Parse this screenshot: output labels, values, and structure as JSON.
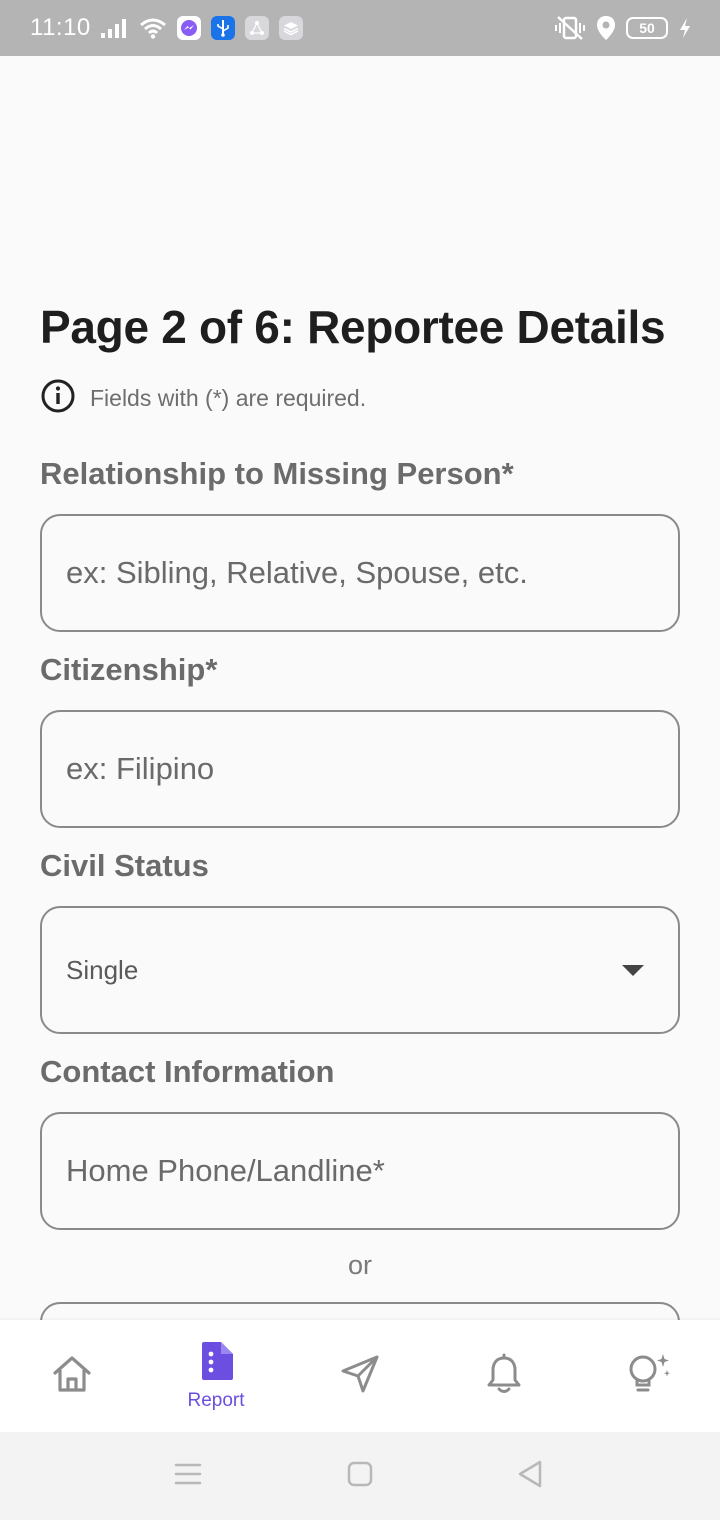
{
  "status_bar": {
    "time": "11:10",
    "battery": "50",
    "app_icons": [
      "messenger-icon",
      "usb-icon",
      "share-icon",
      "layers-icon"
    ],
    "right_icons": [
      "vibrate-off-icon",
      "location-icon",
      "battery-icon",
      "charging-icon"
    ]
  },
  "page": {
    "title": "Page 2 of 6: Reportee Details",
    "required_note": "Fields with (*) are required."
  },
  "form": {
    "relationship": {
      "label": "Relationship to Missing Person*",
      "placeholder": "ex: Sibling, Relative, Spouse, etc.",
      "value": ""
    },
    "citizenship": {
      "label": "Citizenship*",
      "placeholder": "ex: Filipino",
      "value": ""
    },
    "civil_status": {
      "label": "Civil Status",
      "selected": "Single"
    },
    "contact": {
      "label": "Contact Information",
      "home_phone_placeholder": "Home Phone/Landline*",
      "or_text": "or"
    }
  },
  "bottom_nav": {
    "items": [
      {
        "id": "home",
        "icon": "home-icon",
        "label": ""
      },
      {
        "id": "report",
        "icon": "report-document-icon",
        "label": "Report",
        "active": true
      },
      {
        "id": "send",
        "icon": "send-icon",
        "label": ""
      },
      {
        "id": "notifications",
        "icon": "bell-icon",
        "label": ""
      },
      {
        "id": "tips",
        "icon": "lightbulb-icon",
        "label": ""
      }
    ],
    "active_color": "#6c4fe0",
    "inactive_color": "#8c8c8c"
  },
  "system_nav": {
    "buttons": [
      "recents-icon",
      "home-square-icon",
      "back-triangle-icon"
    ]
  }
}
